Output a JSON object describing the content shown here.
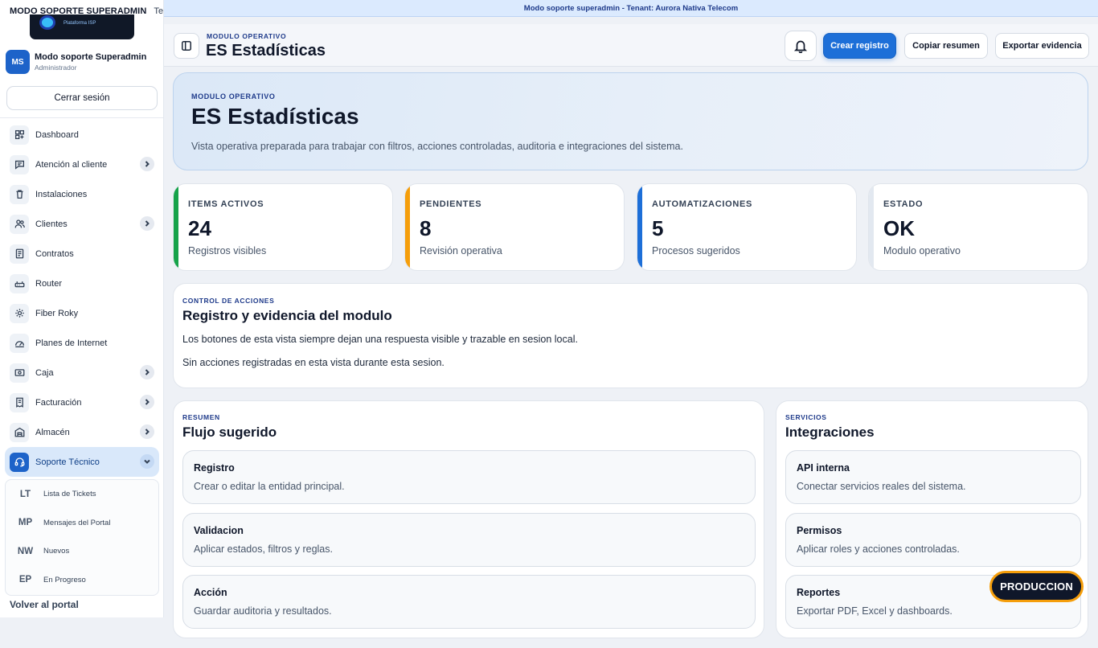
{
  "sidebar": {
    "mode_label": "MODO SOPORTE SUPERADMIN",
    "tenant_prefix": "Tenant",
    "logo_caption": "Plataforma ISP",
    "user": {
      "initials": "MS",
      "name": "Modo soporte Superadmin",
      "role": "Administrador"
    },
    "logout_label": "Cerrar sesión",
    "nav": [
      {
        "label": "Dashboard",
        "icon": "dashboard-icon",
        "has_chevron": false
      },
      {
        "label": "Atención al cliente",
        "icon": "chat-icon",
        "has_chevron": true
      },
      {
        "label": "Instalaciones",
        "icon": "trash-icon",
        "has_chevron": false
      },
      {
        "label": "Clientes",
        "icon": "users-icon",
        "has_chevron": true
      },
      {
        "label": "Contratos",
        "icon": "document-icon",
        "has_chevron": false
      },
      {
        "label": "Router",
        "icon": "router-icon",
        "has_chevron": false
      },
      {
        "label": "Fiber Roky",
        "icon": "sun-icon",
        "has_chevron": false
      },
      {
        "label": "Planes de Internet",
        "icon": "speed-icon",
        "has_chevron": false
      },
      {
        "label": "Caja",
        "icon": "cash-icon",
        "has_chevron": true
      },
      {
        "label": "Facturación",
        "icon": "receipt-icon",
        "has_chevron": true
      },
      {
        "label": "Almacén",
        "icon": "warehouse-icon",
        "has_chevron": true
      },
      {
        "label": "Soporte Técnico",
        "icon": "headset-icon",
        "has_chevron": true,
        "active": true
      }
    ],
    "subnav": [
      {
        "abbr": "LT",
        "label": "Lista de Tickets"
      },
      {
        "abbr": "MP",
        "label": "Mensajes del Portal"
      },
      {
        "abbr": "NW",
        "label": "Nuevos"
      },
      {
        "abbr": "EP",
        "label": "En Progreso"
      }
    ],
    "back_label": "Volver al portal"
  },
  "banner": {
    "text": "Modo soporte superadmin - Tenant: Aurora Nativa Telecom"
  },
  "header": {
    "eyebrow": "MODULO OPERATIVO",
    "title": "ES Estadísticas",
    "primary_button": "Crear registro",
    "copy_button": "Copiar resumen",
    "export_button": "Exportar evidencia"
  },
  "hero": {
    "eyebrow": "MODULO OPERATIVO",
    "title": "ES Estadísticas",
    "description": "Vista operativa preparada para trabajar con filtros, acciones controladas, auditoria e integraciones del sistema."
  },
  "stats": [
    {
      "label": "ITEMS ACTIVOS",
      "value": "24",
      "sub": "Registros visibles",
      "color": "#16a34a"
    },
    {
      "label": "PENDIENTES",
      "value": "8",
      "sub": "Revisión operativa",
      "color": "#f59e0b"
    },
    {
      "label": "AUTOMATIZACIONES",
      "value": "5",
      "sub": "Procesos sugeridos",
      "color": "#1d6fd8"
    },
    {
      "label": "ESTADO",
      "value": "OK",
      "sub": "Modulo operativo",
      "color": "#e2e8f0"
    }
  ],
  "control": {
    "eyebrow": "CONTROL DE ACCIONES",
    "title": "Registro y evidencia del modulo",
    "line1": "Los botones de esta vista siempre dejan una respuesta visible y trazable en sesion local.",
    "line2": "Sin acciones registradas en esta vista durante esta sesion."
  },
  "flow": {
    "eyebrow": "RESUMEN",
    "title": "Flujo sugerido",
    "items": [
      {
        "title": "Registro",
        "desc": "Crear o editar la entidad principal."
      },
      {
        "title": "Validacion",
        "desc": "Aplicar estados, filtros y reglas."
      },
      {
        "title": "Acción",
        "desc": "Guardar auditoria y resultados."
      }
    ]
  },
  "services": {
    "eyebrow": "SERVICIOS",
    "title": "Integraciones",
    "items": [
      {
        "title": "API interna",
        "desc": "Conectar servicios reales del sistema."
      },
      {
        "title": "Permisos",
        "desc": "Aplicar roles y acciones controladas."
      },
      {
        "title": "Reportes",
        "desc": "Exportar PDF, Excel y dashboards."
      }
    ]
  },
  "badge": {
    "label": "PRODUCCION"
  },
  "colors": {
    "accent": "#1d6fd8",
    "badge_border": "#f59e0b",
    "banner": "#dbeafe"
  }
}
